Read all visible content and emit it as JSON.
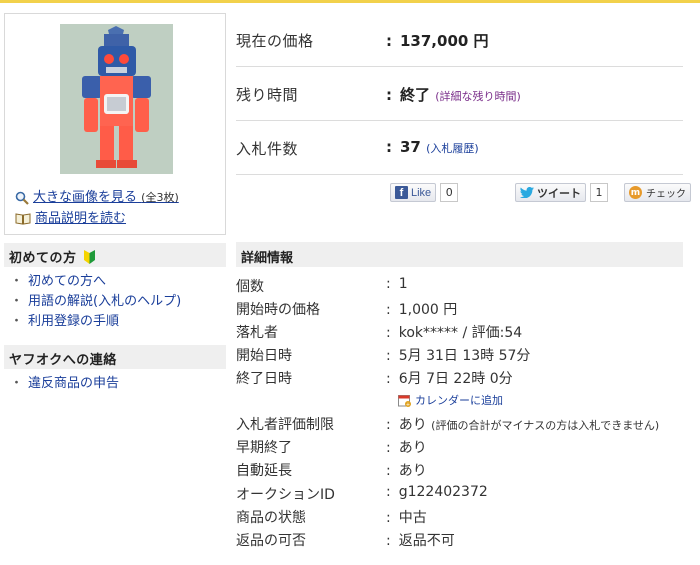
{
  "sidebar": {
    "large_image_link": "大きな画像を見る",
    "image_count": "(全3枚)",
    "description_link": "商品説明を読む",
    "beginner_heading": "初めての方",
    "beginner_links": [
      "初めての方へ",
      "用語の解説(入札のヘルプ)",
      "利用登録の手順"
    ],
    "contact_heading": "ヤフオクへの連絡",
    "contact_links": [
      "違反商品の申告"
    ],
    "bullet": "・"
  },
  "summary": {
    "price_label": "現在の価格",
    "price_value": "137,000 円",
    "time_label": "残り時間",
    "time_value": "終了",
    "time_detail_link": "(詳細な残り時間)",
    "bids_label": "入札件数",
    "bids_value": "37",
    "bids_history_link": "(入札履歴)",
    "colon": ":"
  },
  "social": {
    "fb_like": "Like",
    "fb_count": "0",
    "tweet": "ツイート",
    "tweet_count": "1",
    "check": "チェック"
  },
  "detail": {
    "heading": "詳細情報",
    "rows": [
      {
        "label": "個数",
        "value": "1"
      },
      {
        "label": "開始時の価格",
        "value": "1,000 円"
      },
      {
        "label": "落札者",
        "value": "kok***** / 評価:54"
      },
      {
        "label": "開始日時",
        "value": "5月 31日 13時 57分"
      },
      {
        "label": "終了日時",
        "value": "6月 7日 22時 0分"
      },
      {
        "label": "入札者評価制限",
        "value": "あり",
        "note": "(評価の合計がマイナスの方は入札できません)"
      },
      {
        "label": "早期終了",
        "value": "あり"
      },
      {
        "label": "自動延長",
        "value": "あり"
      },
      {
        "label": "オークションID",
        "value": "g122402372"
      },
      {
        "label": "商品の状態",
        "value": "中古"
      },
      {
        "label": "返品の可否",
        "value": "返品不可"
      }
    ],
    "calendar_link": "カレンダーに追加"
  },
  "colors": {
    "link": "#1a3e9a",
    "accent_bar": "#f2d14b",
    "header_bg": "#efefef"
  },
  "icons": [
    "magnifier-icon",
    "book-icon",
    "beginner-mark-icon",
    "facebook-icon",
    "twitter-bird-icon",
    "check-icon",
    "calendar-icon"
  ]
}
